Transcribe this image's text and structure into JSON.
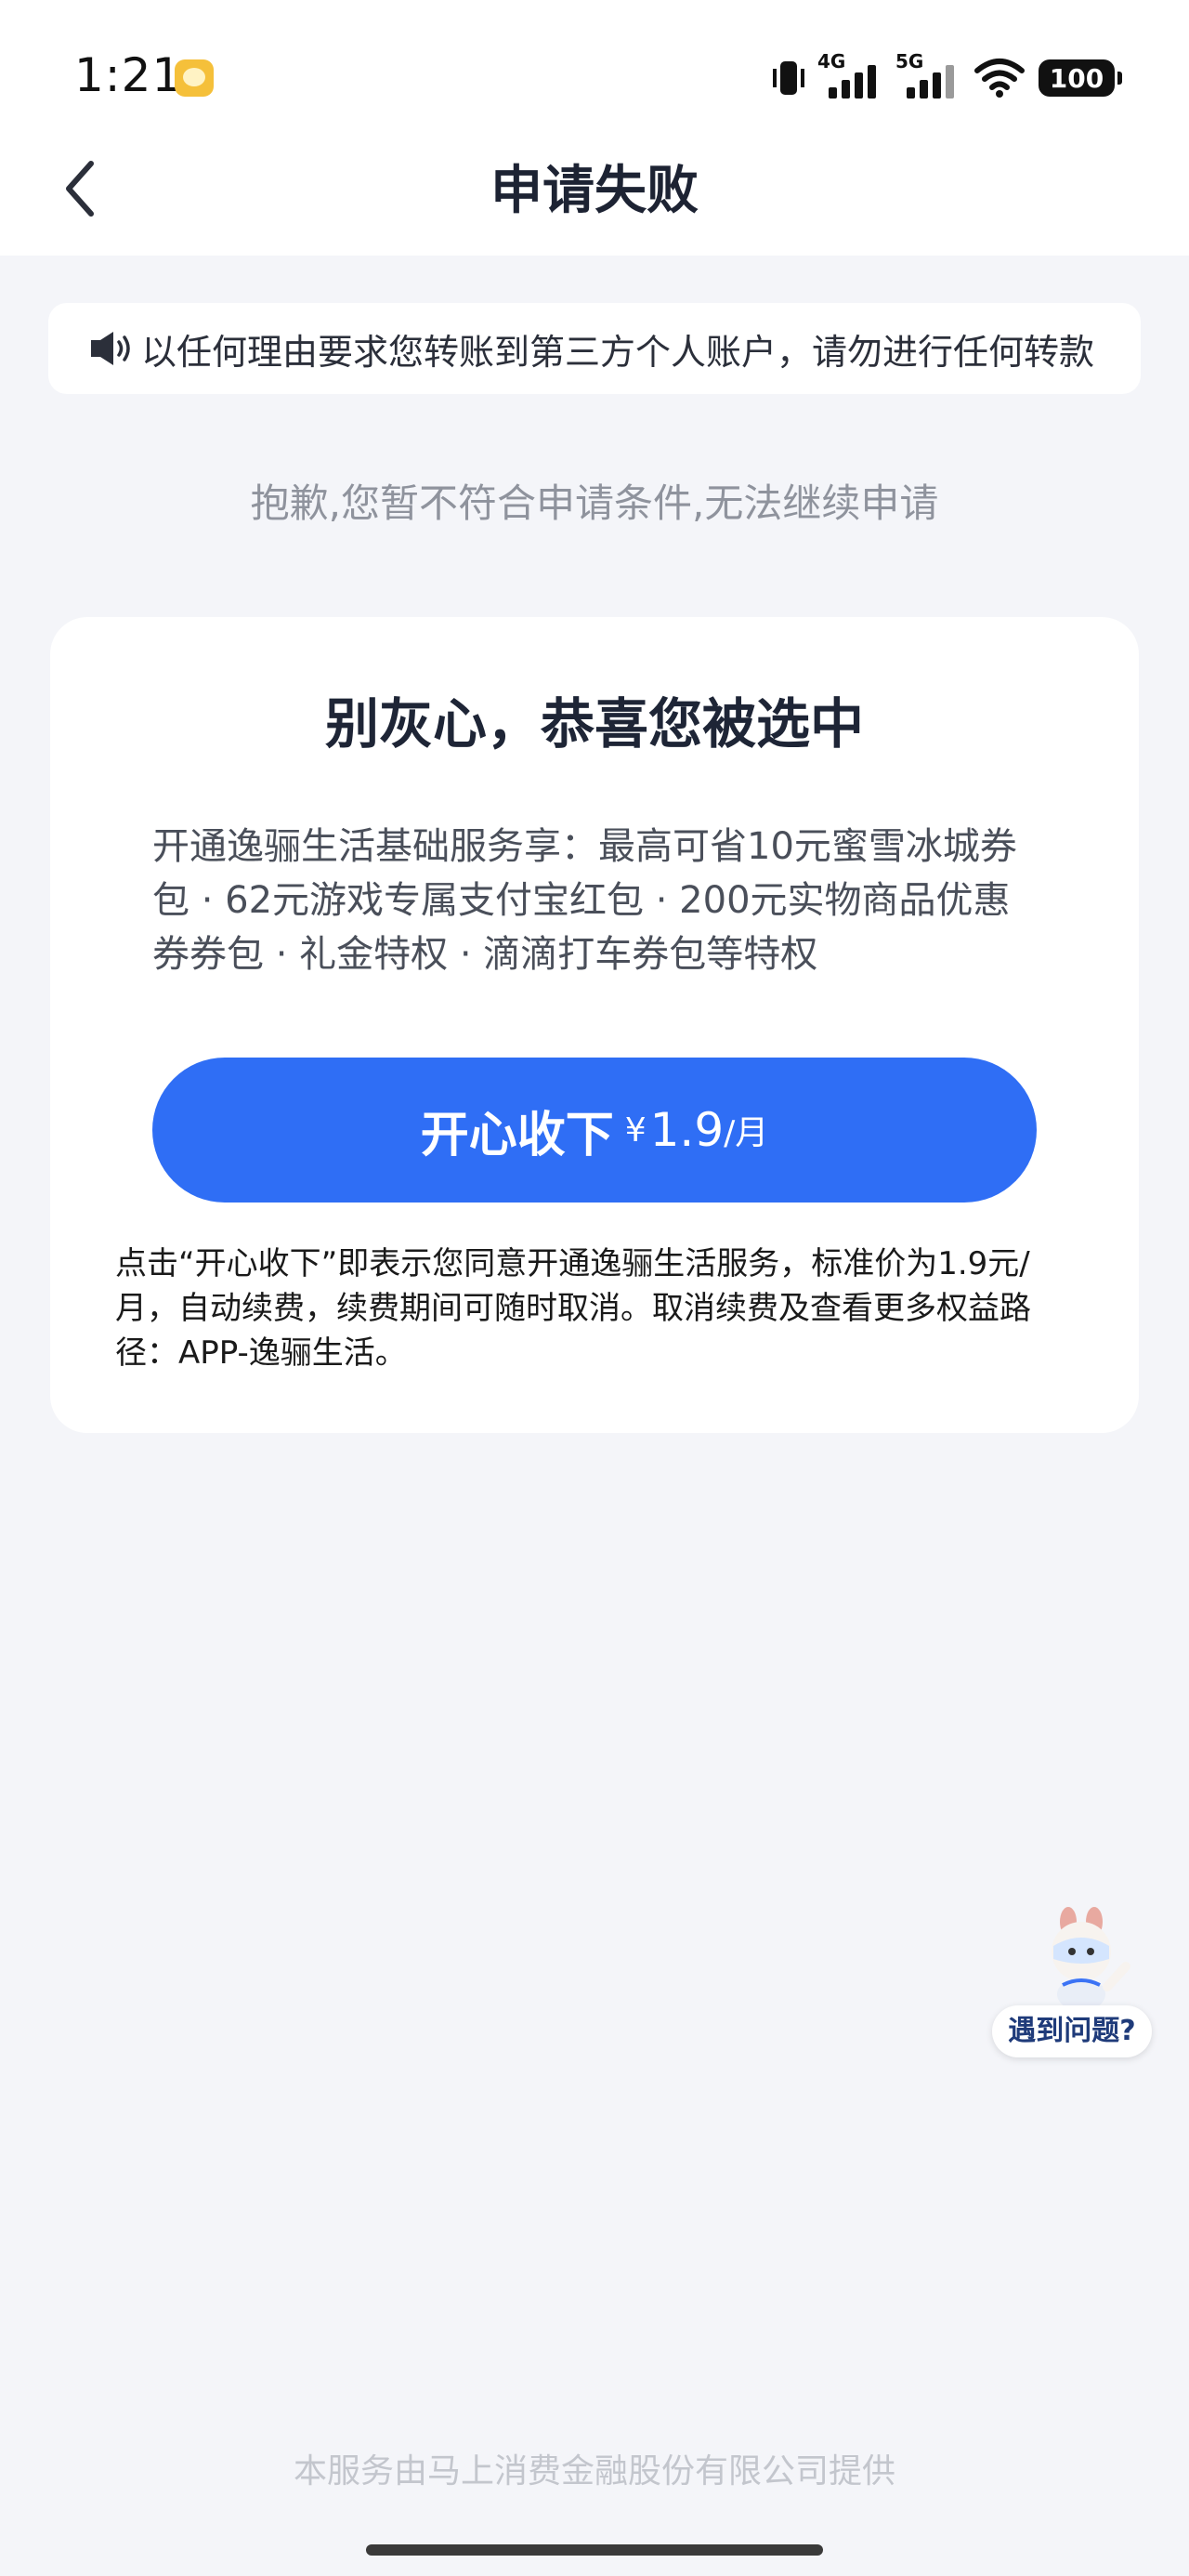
{
  "status_bar": {
    "time": "1:21",
    "net1": "4G",
    "net2": "5G",
    "battery": "100"
  },
  "header": {
    "title": "申请失败"
  },
  "notice": {
    "text": "以任何理由要求您转账到第三方个人账户，请勿进行任何转款"
  },
  "result": {
    "message": "抱歉,您暂不符合申请条件,无法继续申请"
  },
  "offer": {
    "title": "别灰心，恭喜您被选中",
    "description": "开通逸骊生活基础服务享：最高可省10元蜜雪冰城券包 · 62元游戏专属支付宝红包 · 200元实物商品优惠券券包 · 礼金特权 · 滴滴打车券包等特权",
    "button_label": "开心收下",
    "price_symbol": "¥",
    "price": "1.9",
    "price_unit": "/月",
    "terms": "点击“开心收下”即表示您同意开通逸骊生活服务，标准价为1.9元/月，自动续费，续费期间可随时取消。取消续费及查看更多权益路径：APP-逸骊生活。"
  },
  "helper": {
    "label": "遇到问题?"
  },
  "footer": {
    "text": "本服务由马上消费金融股份有限公司提供"
  },
  "colors": {
    "accent": "#2f6ef5",
    "background": "#f4f5f9"
  },
  "icons": [
    "back-icon",
    "speaker-icon",
    "mascot-icon",
    "wifi-icon",
    "vibrate-icon",
    "message-icon"
  ]
}
